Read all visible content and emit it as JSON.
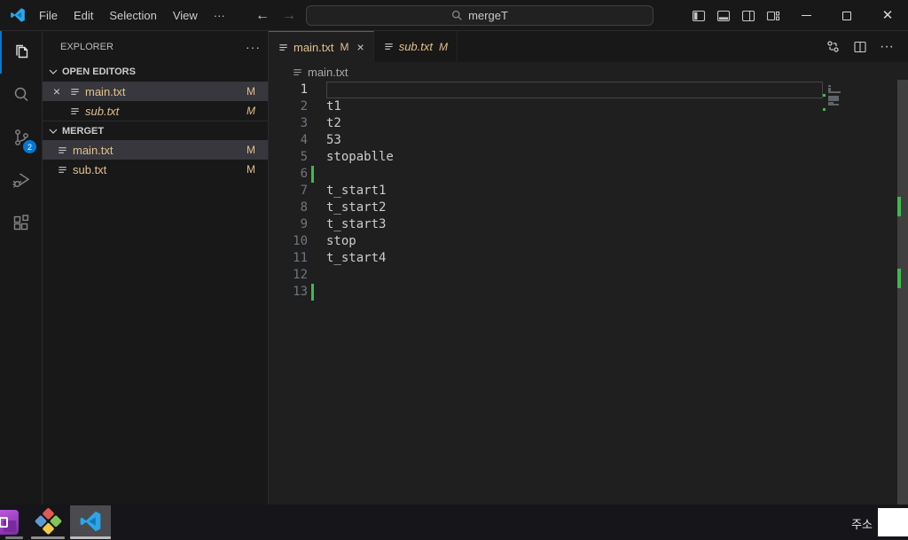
{
  "colors": {
    "accent": "#0078d4",
    "modified": "#e2c08d",
    "git_added": "#3fb950",
    "selection": "#37373d"
  },
  "titlebar": {
    "menus": [
      "File",
      "Edit",
      "Selection",
      "View"
    ],
    "menu_overflow": "···",
    "search_value": "mergeT"
  },
  "activity_bar": {
    "scm_badge": "2"
  },
  "sidebar": {
    "title": "EXPLORER",
    "more": "···",
    "sections": [
      {
        "label": "OPEN EDITORS",
        "items": [
          {
            "name": "main.txt",
            "badge": "M"
          },
          {
            "name": "sub.txt",
            "badge": "M"
          }
        ]
      },
      {
        "label": "MERGET",
        "items": [
          {
            "name": "main.txt",
            "badge": "M"
          },
          {
            "name": "sub.txt",
            "badge": "M"
          }
        ]
      }
    ]
  },
  "editor": {
    "tabs": [
      {
        "name": "main.txt",
        "badge": "M"
      },
      {
        "name": "sub.txt",
        "badge": "M"
      }
    ],
    "more": "···",
    "breadcrumb": "main.txt",
    "lines": [
      {
        "n": 1,
        "text": "",
        "current": true
      },
      {
        "n": 2,
        "text": "t1"
      },
      {
        "n": 3,
        "text": "t2"
      },
      {
        "n": 4,
        "text": "53"
      },
      {
        "n": 5,
        "text": "stopablle"
      },
      {
        "n": 6,
        "text": "",
        "added": true
      },
      {
        "n": 7,
        "text": "t_start1"
      },
      {
        "n": 8,
        "text": "t_start2"
      },
      {
        "n": 9,
        "text": "t_start3"
      },
      {
        "n": 10,
        "text": "stop"
      },
      {
        "n": 11,
        "text": "t_start4"
      },
      {
        "n": 12,
        "text": ""
      },
      {
        "n": 13,
        "text": "",
        "added": true
      }
    ]
  },
  "taskbar": {
    "address_label": "주소"
  }
}
